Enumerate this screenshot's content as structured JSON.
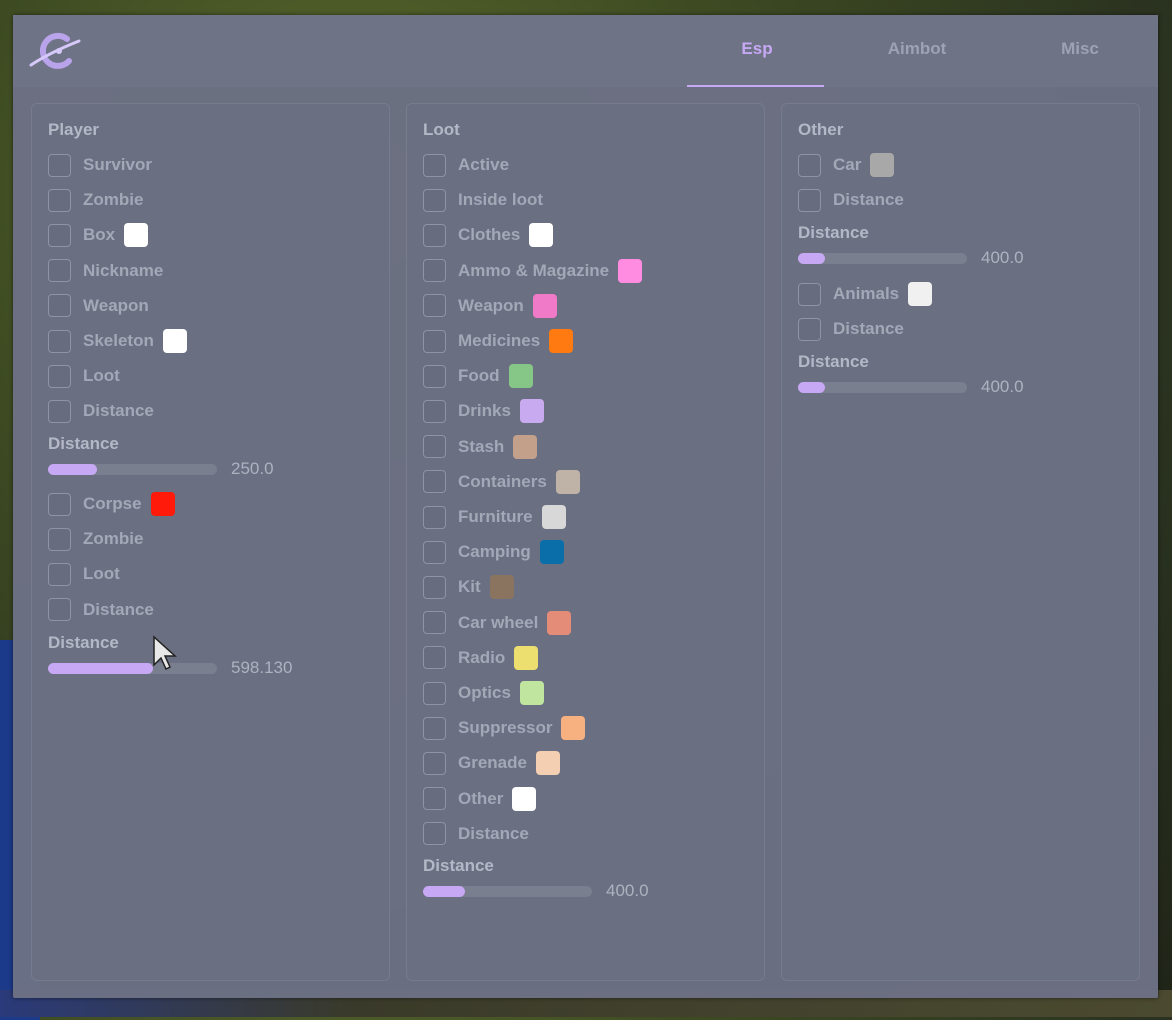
{
  "tabs": [
    "Esp",
    "Aimbot",
    "Misc"
  ],
  "active_tab": "Esp",
  "accent": "#c6a8f4",
  "player": {
    "title": "Player",
    "items_a": [
      {
        "label": "Survivor",
        "color": null
      },
      {
        "label": "Zombie",
        "color": null
      },
      {
        "label": "Box",
        "color": "#ffffff"
      },
      {
        "label": "Nickname",
        "color": null
      },
      {
        "label": "Weapon",
        "color": null
      },
      {
        "label": "Skeleton",
        "color": "#ffffff"
      },
      {
        "label": "Loot",
        "color": null
      },
      {
        "label": "Distance",
        "color": null
      }
    ],
    "slider_a": {
      "label": "Distance",
      "value": "250.0",
      "fraction": 0.29
    },
    "items_b": [
      {
        "label": "Corpse",
        "color": "#ff1a0a"
      },
      {
        "label": "Zombie",
        "color": null
      },
      {
        "label": "Loot",
        "color": null
      },
      {
        "label": "Distance",
        "color": null
      }
    ],
    "slider_b": {
      "label": "Distance",
      "value": "598.130",
      "fraction": 0.62
    }
  },
  "loot": {
    "title": "Loot",
    "items": [
      {
        "label": "Active",
        "color": null
      },
      {
        "label": "Inside loot",
        "color": null
      },
      {
        "label": "Clothes",
        "color": "#ffffff"
      },
      {
        "label": "Ammo & Magazine",
        "color": "#ff8ce0"
      },
      {
        "label": "Weapon",
        "color": "#f07ac8"
      },
      {
        "label": "Medicines",
        "color": "#ff7a10"
      },
      {
        "label": "Food",
        "color": "#86c787"
      },
      {
        "label": "Drinks",
        "color": "#c8aaf0"
      },
      {
        "label": "Stash",
        "color": "#c2a08a"
      },
      {
        "label": "Containers",
        "color": "#bfb2a6"
      },
      {
        "label": "Furniture",
        "color": "#d8d8d8"
      },
      {
        "label": "Camping",
        "color": "#0a6fa8"
      },
      {
        "label": "Kit",
        "color": "#8a7460"
      },
      {
        "label": "Car wheel",
        "color": "#e58c78"
      },
      {
        "label": "Radio",
        "color": "#ecdf70"
      },
      {
        "label": "Optics",
        "color": "#bfe59e"
      },
      {
        "label": "Suppressor",
        "color": "#f7b080"
      },
      {
        "label": "Grenade",
        "color": "#f4cfb2"
      },
      {
        "label": "Other",
        "color": "#ffffff"
      },
      {
        "label": "Distance",
        "color": null
      }
    ],
    "slider": {
      "label": "Distance",
      "value": "400.0",
      "fraction": 0.25
    }
  },
  "other": {
    "title": "Other",
    "items_a": [
      {
        "label": "Car",
        "color": "#a8a8a8"
      },
      {
        "label": "Distance",
        "color": null
      }
    ],
    "slider_a": {
      "label": "Distance",
      "value": "400.0",
      "fraction": 0.16
    },
    "items_b": [
      {
        "label": "Animals",
        "color": "#f0f0f0"
      },
      {
        "label": "Distance",
        "color": null
      }
    ],
    "slider_b": {
      "label": "Distance",
      "value": "400.0",
      "fraction": 0.16
    }
  }
}
